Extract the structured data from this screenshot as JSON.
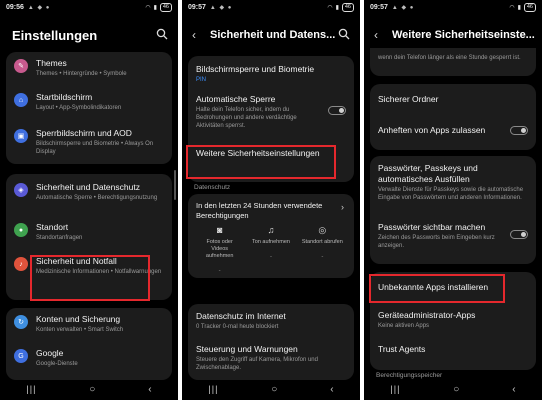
{
  "colors": {
    "highlight": "#e5282d",
    "card": "#1c1c1c",
    "link_blue": "#3e91ff"
  },
  "status_bar": [
    {
      "time": "09:56",
      "battery": "46"
    },
    {
      "time": "09:57",
      "battery": "46"
    },
    {
      "time": "09:57",
      "battery": "46"
    }
  ],
  "screen1": {
    "title": "Einstellungen",
    "items": [
      {
        "title": "Themes",
        "sub": "Themes • Hintergründe • Symbole",
        "icon": "palette-icon",
        "color": "#c85a8e"
      },
      {
        "title": "Startbildschirm",
        "sub": "Layout • App-Symbolindikatoren",
        "icon": "home-icon",
        "color": "#3f6fe0"
      },
      {
        "title": "Sperrbildschirm und AOD",
        "sub": "Bildschirmsperre und Biometrie • Always On Display",
        "icon": "lock-icon",
        "color": "#3f6fe0"
      },
      {
        "title": "Sicherheit und Datenschutz",
        "sub": "Automatische Sperre • Berechtigungsnutzung",
        "icon": "shield-icon",
        "color": "#5a5ad6"
      },
      {
        "title": "Standort",
        "sub": "Standortanfragen",
        "icon": "location-icon",
        "color": "#3fa24f"
      },
      {
        "title": "Sicherheit und Notfall",
        "sub": "Medizinische Informationen • Notfallwarnungen",
        "icon": "bell-icon",
        "color": "#e0533c"
      },
      {
        "title": "Konten und Sicherung",
        "sub": "Konten verwalten • Smart Switch",
        "icon": "sync-icon",
        "color": "#3f8fe0"
      },
      {
        "title": "Google",
        "sub": "Google-Dienste",
        "icon": "google-icon",
        "color": "#3f6fe0"
      }
    ]
  },
  "screen2": {
    "title": "Sicherheit und Datens...",
    "items": {
      "lock": {
        "title": "Bildschirmsperre und Biometrie",
        "sub": "PIN"
      },
      "autolock": {
        "title": "Automatische Sperre",
        "sub": "Halte dein Telefon sicher, indem du Bedrohungen und andere verdächtige Aktivitäten sperrst."
      },
      "more": {
        "title": "Weitere Sicherheitseinstellungen"
      }
    },
    "section": "Datenschutz",
    "permissions": {
      "header": "In den letzten 24 Stunden verwendete Berechtigungen",
      "cols": [
        {
          "label": "Fotos oder Videos aufnehmen",
          "value": "-",
          "icon": "camera-icon"
        },
        {
          "label": "Ton aufnehmen",
          "value": "-",
          "icon": "mic-icon"
        },
        {
          "label": "Standort abrufen",
          "value": "-",
          "icon": "location-icon"
        }
      ]
    },
    "internet": {
      "title": "Datenschutz im Internet",
      "sub": "0 Tracker 0-mal heute blockiert"
    },
    "control": {
      "title": "Steuerung und Warnungen",
      "sub": "Steuere den Zugriff auf Kamera, Mikrofon und Zwischenablage."
    }
  },
  "screen3": {
    "title": "Weitere Sicherheitseinste...",
    "top_text": "wenn dein Telefon länger als eine Stunde gesperrt ist.",
    "folder": "Sicherer Ordner",
    "pin_apps": "Anheften von Apps zulassen",
    "passwords": {
      "title": "Passwörter, Passkeys und automatisches Ausfüllen",
      "sub": "Verwalte Dienste für Passkeys sowie die automatische Eingabe von Passwörtern und anderen Informationen."
    },
    "visible_pw": {
      "title": "Passwörter sichtbar machen",
      "sub": "Zeichen des Passworts beim Eingeben kurz anzeigen."
    },
    "unknown_apps": "Unbekannte Apps installieren",
    "device_admin": {
      "title": "Geräteadministrator-Apps",
      "sub": "Keine aktiven Apps"
    },
    "trust": "Trust Agents",
    "section": "Berechtigungsspeicher"
  },
  "nav": {
    "recent": "|||",
    "home": "○",
    "back": "‹"
  }
}
